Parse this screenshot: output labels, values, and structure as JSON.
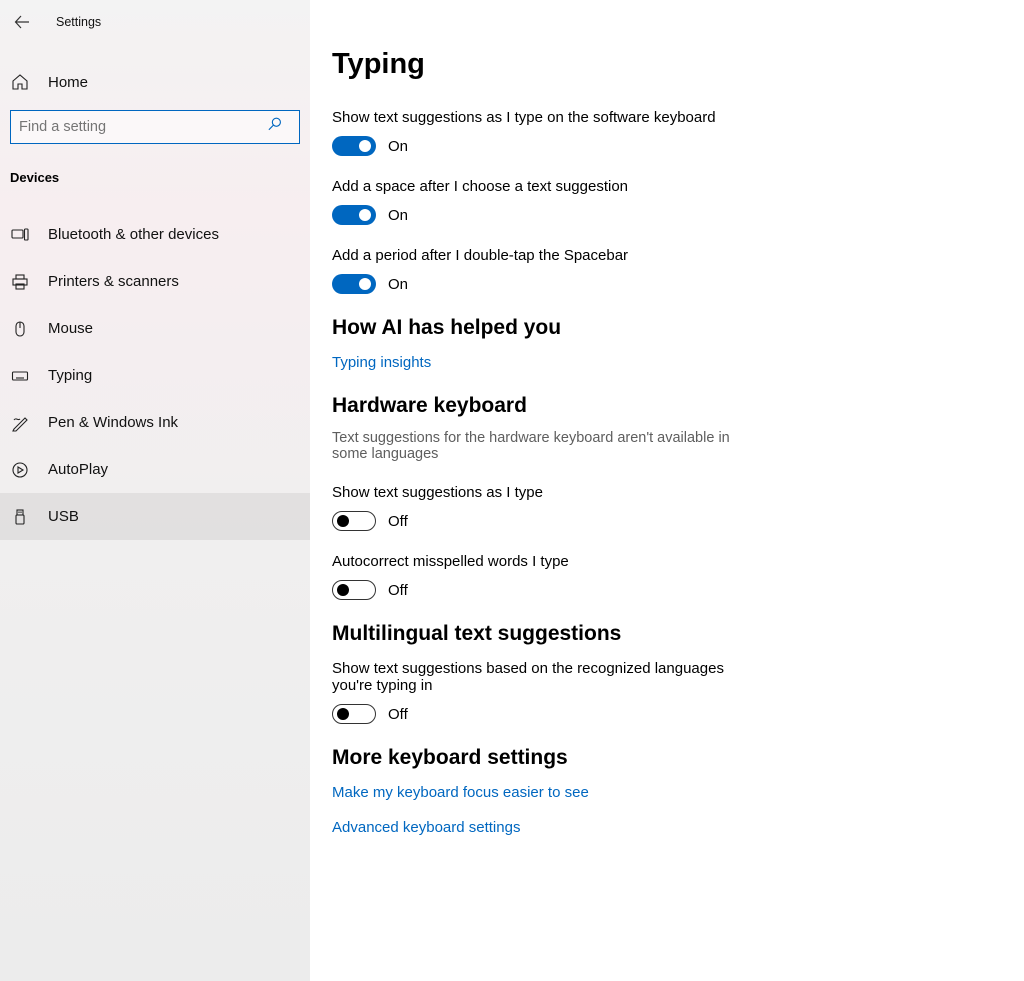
{
  "window_title": "Settings",
  "home_label": "Home",
  "search_placeholder": "Find a setting",
  "category_label": "Devices",
  "nav": [
    {
      "label": "Bluetooth & other devices"
    },
    {
      "label": "Printers & scanners"
    },
    {
      "label": "Mouse"
    },
    {
      "label": "Typing"
    },
    {
      "label": "Pen & Windows Ink"
    },
    {
      "label": "AutoPlay"
    },
    {
      "label": "USB"
    }
  ],
  "page_title": "Typing",
  "settings_a": [
    {
      "label": "Show text suggestions as I type on the software keyboard",
      "state": "On",
      "on": true
    },
    {
      "label": "Add a space after I choose a text suggestion",
      "state": "On",
      "on": true
    },
    {
      "label": "Add a period after I double-tap the Spacebar",
      "state": "On",
      "on": true
    }
  ],
  "section_ai": {
    "title": "How AI has helped you",
    "link": "Typing insights"
  },
  "section_hw": {
    "title": "Hardware keyboard",
    "desc": "Text suggestions for the hardware keyboard aren't available in some languages",
    "settings": [
      {
        "label": "Show text suggestions as I type",
        "state": "Off",
        "on": false
      },
      {
        "label": "Autocorrect misspelled words I type",
        "state": "Off",
        "on": false
      }
    ]
  },
  "section_multi": {
    "title": "Multilingual text suggestions",
    "label": "Show text suggestions based on the recognized languages you're typing in",
    "state": "Off",
    "on": false
  },
  "section_more": {
    "title": "More keyboard settings",
    "links": [
      "Make my keyboard focus easier to see",
      "Advanced keyboard settings"
    ]
  },
  "state_on": "On",
  "state_off": "Off"
}
